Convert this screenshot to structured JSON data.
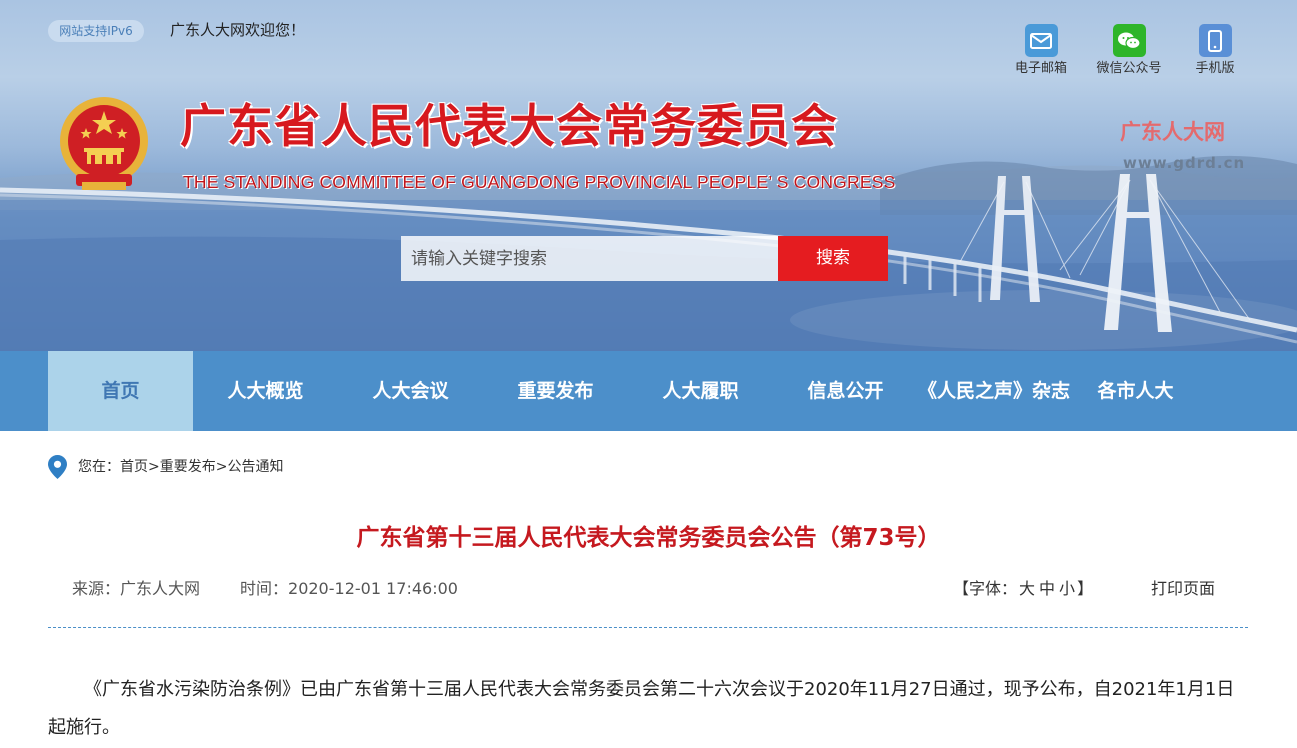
{
  "top": {
    "ipv6_badge": "网站支持IPv6",
    "welcome": "广东人大网欢迎您！"
  },
  "quick_links": [
    {
      "label": "电子邮箱",
      "icon": "mail-icon",
      "color": "#4a9ad8"
    },
    {
      "label": "微信公众号",
      "icon": "wechat-icon",
      "color": "#2eb52a"
    },
    {
      "label": "手机版",
      "icon": "mobile-icon",
      "color": "#5a8fd6"
    }
  ],
  "header": {
    "title_cn": "广东省人民代表大会常务委员会",
    "title_en": "THE STANDING COMMITTEE OF GUANGDONG PROVINCIAL PEOPLE’ S CONGRESS",
    "brand_cn": "广东人大网",
    "brand_url": "www.gdrd.cn"
  },
  "search": {
    "placeholder": "请输入关键字搜索",
    "button": "搜索"
  },
  "nav": {
    "items": [
      "首页",
      "人大概览",
      "人大会议",
      "重要发布",
      "人大履职",
      "信息公开",
      "《人民之声》杂志",
      "各市人大"
    ],
    "active_index": 0
  },
  "breadcrumb": {
    "prefix": "您在：",
    "items": [
      "首页",
      "重要发布",
      "公告通知"
    ],
    "separator": ">"
  },
  "article": {
    "title": "广东省第十三届人民代表大会常务委员会公告（第73号）",
    "source": "来源：广东人大网",
    "time": "时间：2020-12-01 17:46:00",
    "font_label_open": "【字体：",
    "font_sizes": [
      "大",
      "中",
      "小"
    ],
    "font_label_close": "】",
    "print": "打印页面",
    "body": "《广东省水污染防治条例》已由广东省第十三届人民代表大会常务委员会第二十六次会议于2020年11月27日通过，现予公布，自2021年1月1日起施行。"
  },
  "colors": {
    "nav_bg": "#4c8fca",
    "nav_active_bg": "#acd3ea",
    "accent_red": "#e51c20",
    "title_red": "#c5191f"
  }
}
